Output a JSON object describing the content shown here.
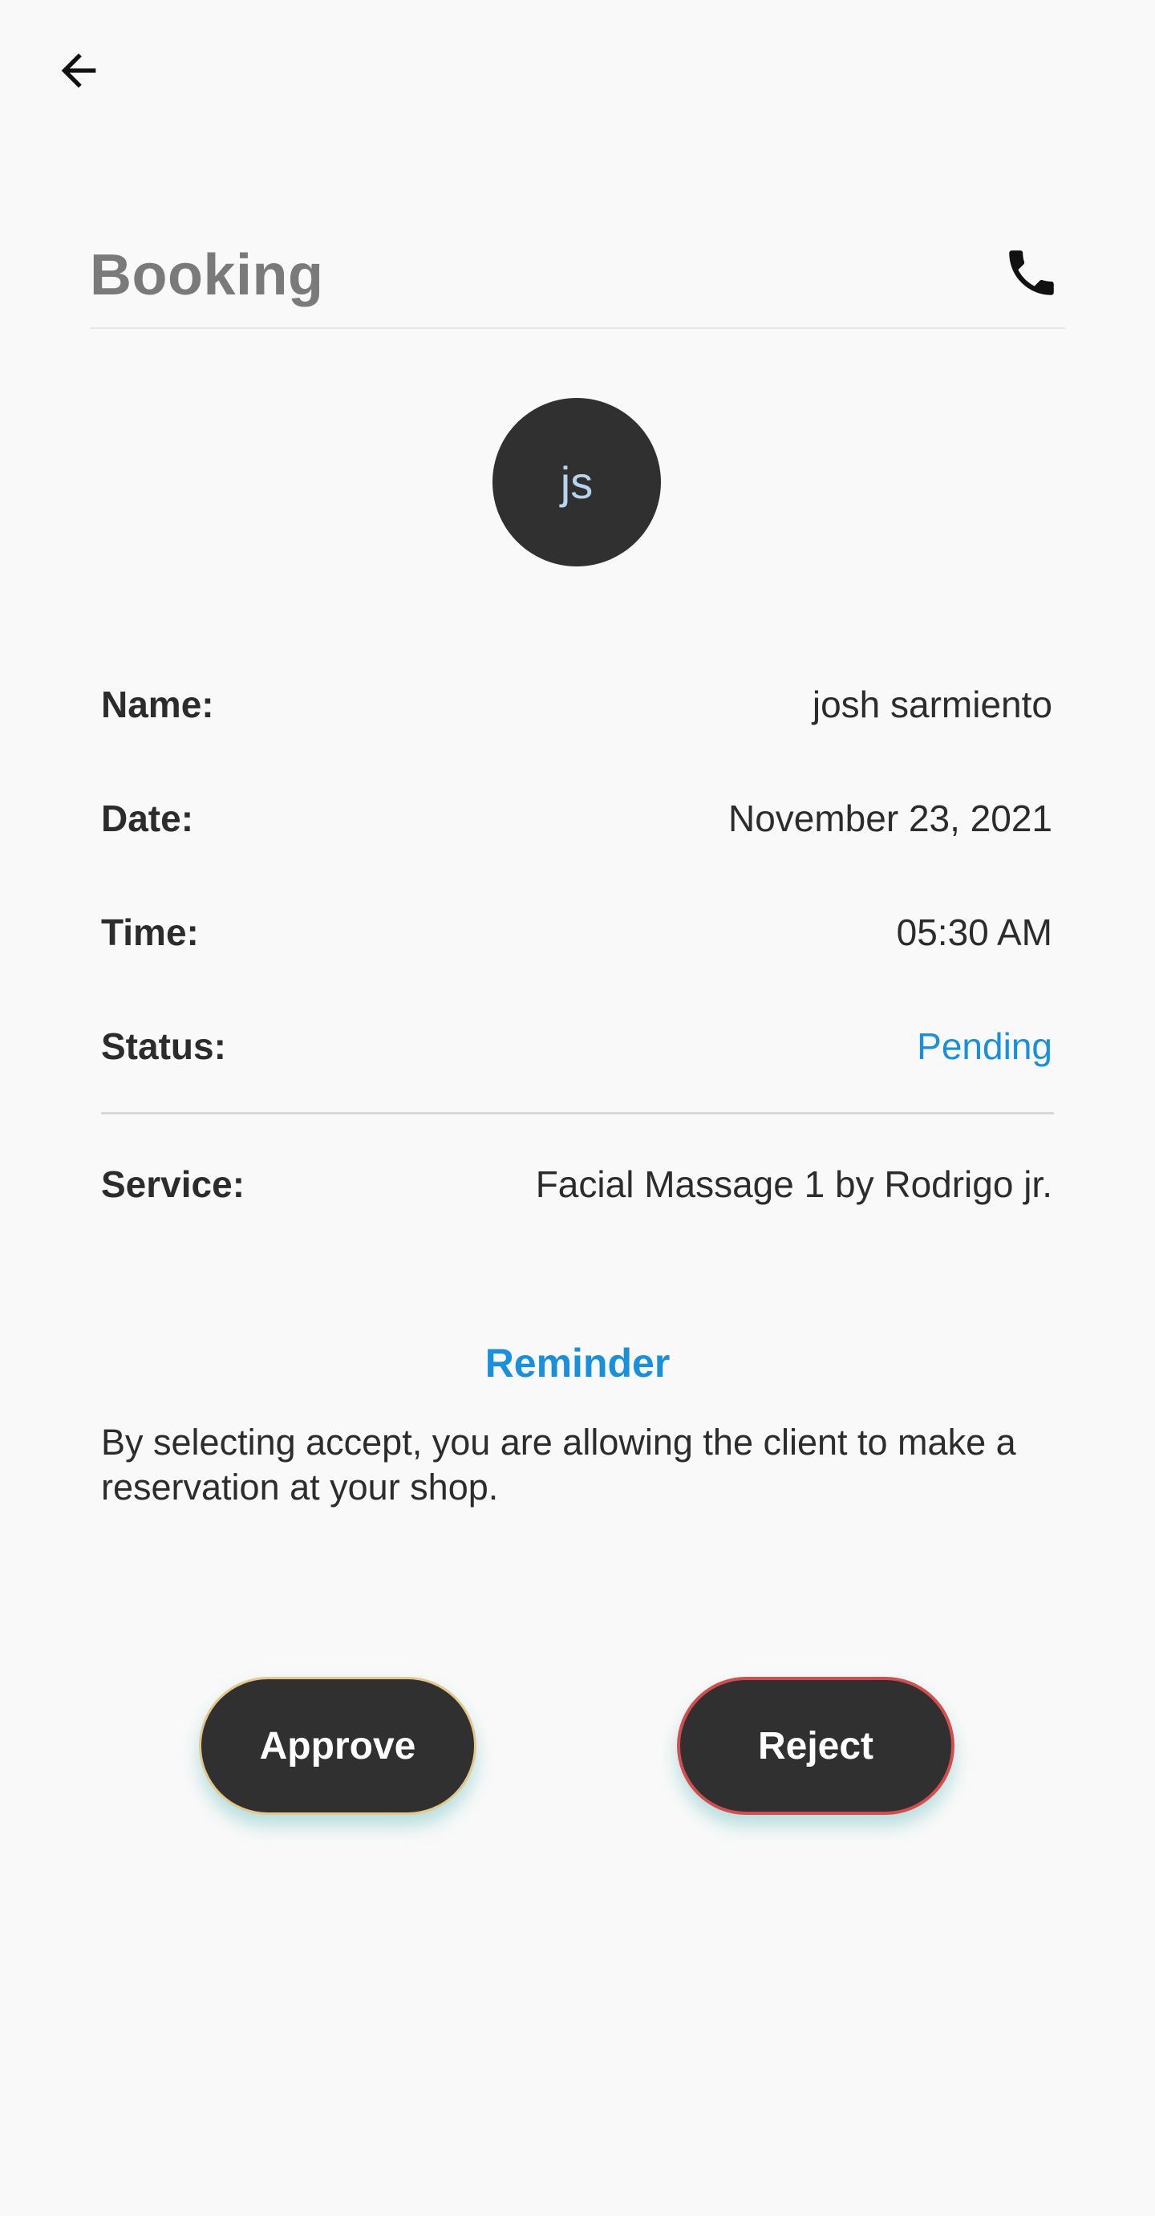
{
  "header": {
    "title": "Booking"
  },
  "icons": {
    "back": "arrow-left-icon",
    "call": "phone-icon"
  },
  "avatar": {
    "initials": "js"
  },
  "details": {
    "name": {
      "label": "Name:",
      "value": "josh sarmiento"
    },
    "date": {
      "label": "Date:",
      "value": "November 23, 2021"
    },
    "time": {
      "label": "Time:",
      "value": "05:30 AM"
    },
    "status": {
      "label": "Status:",
      "value": "Pending",
      "color": "#1a90dc"
    },
    "service": {
      "label": "Service:",
      "value": "Facial Massage 1 by Rodrigo jr."
    }
  },
  "reminder": {
    "title": "Reminder",
    "text": "By selecting accept, you are allowing the client to make a reservation at your shop."
  },
  "actions": {
    "approve_label": "Approve",
    "reject_label": "Reject"
  },
  "colors": {
    "background": "#f9f9f9",
    "button": "#303030",
    "accent": "#1a90dc",
    "approve_border": "#e4c78a",
    "reject_border": "#d64b50"
  }
}
